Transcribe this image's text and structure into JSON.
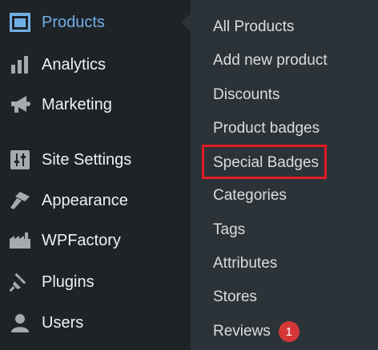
{
  "sidebar": {
    "items": [
      {
        "label": "Products",
        "icon": "archive-box-icon",
        "active": true
      },
      {
        "label": "Analytics",
        "icon": "bar-chart-icon"
      },
      {
        "label": "Marketing",
        "icon": "megaphone-icon"
      },
      {
        "label": "Site Settings",
        "icon": "sliders-icon"
      },
      {
        "label": "Appearance",
        "icon": "paintbrush-icon"
      },
      {
        "label": "WPFactory",
        "icon": "factory-icon"
      },
      {
        "label": "Plugins",
        "icon": "plug-icon"
      },
      {
        "label": "Users",
        "icon": "user-icon"
      }
    ]
  },
  "submenu": {
    "items": [
      {
        "label": "All Products"
      },
      {
        "label": "Add new product"
      },
      {
        "label": "Discounts"
      },
      {
        "label": "Product badges"
      },
      {
        "label": "Special Badges",
        "highlighted": true
      },
      {
        "label": "Categories"
      },
      {
        "label": "Tags"
      },
      {
        "label": "Attributes"
      },
      {
        "label": "Stores"
      },
      {
        "label": "Reviews",
        "badge": "1"
      }
    ]
  },
  "colors": {
    "sidebar_bg": "#1d2327",
    "submenu_bg": "#2c3338",
    "active_text": "#72aee6",
    "highlight_border": "#e01b24",
    "badge_bg": "#d63638"
  }
}
